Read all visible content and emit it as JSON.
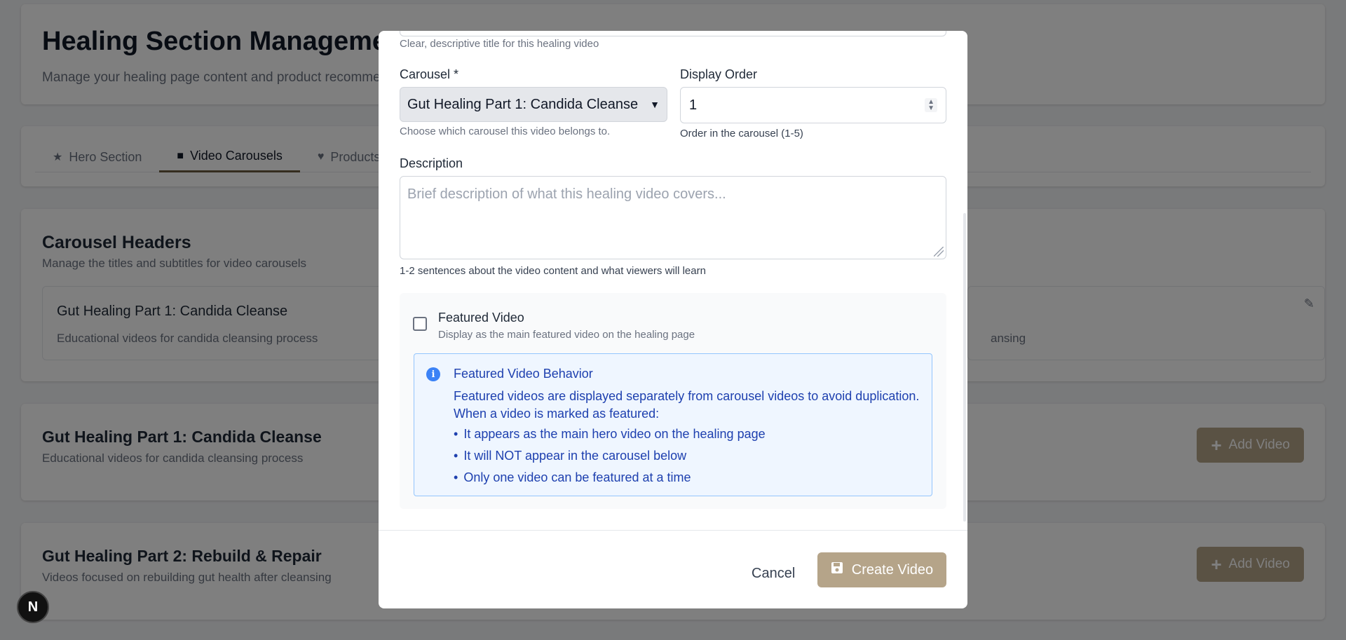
{
  "page": {
    "title": "Healing Section Management",
    "subtitle": "Manage your healing page content and product recommendations"
  },
  "tabs": [
    {
      "label": "Hero Section",
      "icon": "star-icon"
    },
    {
      "label": "Video Carousels",
      "icon": "video-camera-icon"
    },
    {
      "label": "Products",
      "icon": "heart-pulse-icon"
    }
  ],
  "carousel_headers": {
    "title": "Carousel Headers",
    "subtitle": "Manage the titles and subtitles for video carousels",
    "items": [
      {
        "title": "Gut Healing Part 1: Candida Cleanse",
        "description": "Educational videos for candida cleansing process"
      },
      {
        "title": "",
        "description": "ansing"
      }
    ]
  },
  "sections": [
    {
      "title": "Gut Healing Part 1: Candida Cleanse",
      "description": "Educational videos for candida cleansing process",
      "button": "Add Video"
    },
    {
      "title": "Gut Healing Part 2: Rebuild & Repair",
      "description": "Videos focused on rebuilding gut health after cleansing",
      "button": "Add Video"
    }
  ],
  "modal": {
    "title_help": "Clear, descriptive title for this healing video",
    "carousel_label": "Carousel *",
    "carousel_value": "Gut Healing Part 1: Candida Cleanse",
    "carousel_help": "Choose which carousel this video belongs to.",
    "order_label": "Display Order",
    "order_value": "1",
    "order_help": "Order in the carousel (1-5)",
    "description_label": "Description",
    "description_placeholder": "Brief description of what this healing video covers...",
    "description_help": "1-2 sentences about the video content and what viewers will learn",
    "featured_label": "Featured Video",
    "featured_help": "Display as the main featured video on the healing page",
    "featured_checked": false,
    "info": {
      "title": "Featured Video Behavior",
      "text": "Featured videos are displayed separately from carousel videos to avoid duplication. When a video is marked as featured:",
      "bullets": [
        "It appears as the main hero video on the healing page",
        "It will NOT appear in the carousel below",
        "Only one video can be featured at a time"
      ]
    },
    "cancel_label": "Cancel",
    "create_label": "Create Video"
  },
  "badge": "N",
  "colors": {
    "accent": "#b5a489",
    "info_bg": "#eff6ff",
    "info_text": "#1e40af"
  }
}
